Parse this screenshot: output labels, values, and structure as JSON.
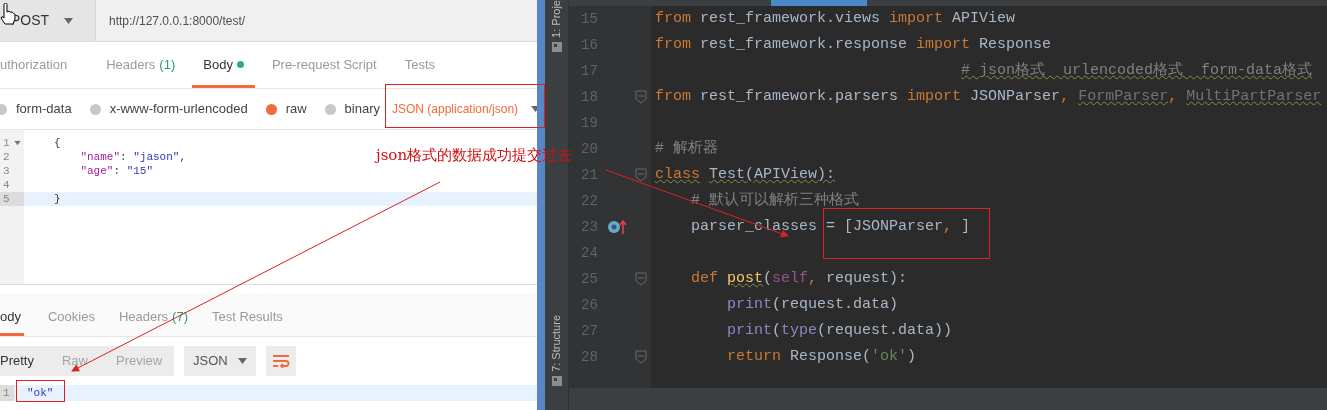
{
  "request": {
    "method": "POST",
    "url": "http://127.0.0.1:8000/test/",
    "tabs": [
      {
        "label": "uthorization",
        "selected": false
      },
      {
        "label": "Headers",
        "count": "(1)",
        "selected": false
      },
      {
        "label": "Body",
        "dot": true,
        "selected": true
      },
      {
        "label": "Pre-request Script",
        "selected": false
      },
      {
        "label": "Tests",
        "selected": false
      }
    ],
    "body_types": [
      {
        "label": "form-data",
        "selected": false
      },
      {
        "label": "x-www-form-urlencoded",
        "selected": false
      },
      {
        "label": "raw",
        "selected": true
      },
      {
        "label": "binary",
        "selected": false
      }
    ],
    "content_type": "JSON (application/json)",
    "editor_lines": [
      {
        "number": "1",
        "fold": true,
        "current": false,
        "tokens": [
          {
            "kind": "punct",
            "text": "{"
          }
        ]
      },
      {
        "number": "2",
        "fold": false,
        "current": false,
        "tokens": [
          {
            "kind": "key",
            "text": "    \"name\""
          },
          {
            "kind": "punct",
            "text": ": "
          },
          {
            "kind": "value",
            "text": "\"jason\""
          },
          {
            "kind": "punct",
            "text": ","
          }
        ]
      },
      {
        "number": "3",
        "fold": false,
        "current": false,
        "tokens": [
          {
            "kind": "key",
            "text": "    \"age\""
          },
          {
            "kind": "punct",
            "text": ": "
          },
          {
            "kind": "value",
            "text": "\"15\""
          }
        ]
      },
      {
        "number": "4",
        "fold": false,
        "current": false
      },
      {
        "number": "5",
        "fold": false,
        "current": true,
        "tokens": [
          {
            "kind": "punct",
            "text": "}"
          }
        ]
      }
    ]
  },
  "response": {
    "tabs": [
      {
        "label": "ody",
        "selected": true
      },
      {
        "label": "Cookies",
        "selected": false
      },
      {
        "label": "Headers",
        "count": "(7)",
        "selected": false
      },
      {
        "label": "Test Results",
        "selected": false
      }
    ],
    "view_modes": [
      {
        "label": "Pretty",
        "selected": true
      },
      {
        "label": "Raw",
        "selected": false
      },
      {
        "label": "Preview",
        "selected": false
      }
    ],
    "format": "JSON",
    "lines": [
      {
        "number": "1",
        "text": "\"ok\""
      }
    ]
  },
  "ide": {
    "tool_tabs": [
      {
        "label": "1: Proje"
      },
      {
        "label": "7: Structure"
      }
    ],
    "lines": [
      {
        "number": "15",
        "fold": false,
        "marker": false,
        "tokens": [
          {
            "kind": "kw",
            "text": "from"
          },
          {
            "kind": "plain",
            "text": " rest_framework.views "
          },
          {
            "kind": "kw",
            "text": "import"
          },
          {
            "kind": "plain",
            "text": " APIView"
          }
        ]
      },
      {
        "number": "16",
        "fold": false,
        "marker": false,
        "tokens": [
          {
            "kind": "kw",
            "text": "from"
          },
          {
            "kind": "plain",
            "text": " rest_framework.response "
          },
          {
            "kind": "kw",
            "text": "import"
          },
          {
            "kind": "plain",
            "text": " Response"
          }
        ]
      },
      {
        "number": "17",
        "fold": false,
        "marker": false,
        "tokens": [
          {
            "kind": "comment",
            "text": "                                  # json格式  urlencoded格式  form-data格式",
            "warn": true
          }
        ]
      },
      {
        "number": "18",
        "fold": true,
        "marker": false,
        "tokens": [
          {
            "kind": "kw",
            "text": "from"
          },
          {
            "kind": "plain",
            "text": " rest_framework.parsers "
          },
          {
            "kind": "kw",
            "text": "import"
          },
          {
            "kind": "plain",
            "text": " JSONParser"
          },
          {
            "kind": "kw",
            "text": ", "
          },
          {
            "kind": "unused",
            "text": "FormParser",
            "warn": true
          },
          {
            "kind": "kw",
            "text": ", "
          },
          {
            "kind": "unused",
            "text": "MultiPartParser",
            "warn": true
          }
        ]
      },
      {
        "number": "19",
        "fold": false,
        "marker": false
      },
      {
        "number": "20",
        "fold": false,
        "marker": false,
        "tokens": [
          {
            "kind": "comment",
            "text": "# 解析器"
          }
        ]
      },
      {
        "number": "21",
        "fold": true,
        "marker": false,
        "tokens": [
          {
            "kind": "kw",
            "text": "class",
            "warn": true
          },
          {
            "kind": "plain",
            "text": " Test(APIView):",
            "warn": true
          }
        ]
      },
      {
        "number": "22",
        "fold": false,
        "marker": false,
        "tokens": [
          {
            "kind": "comment",
            "text": "    # 默认可以解析三种格式"
          }
        ]
      },
      {
        "number": "23",
        "fold": false,
        "marker": true,
        "tokens": [
          {
            "kind": "plain",
            "text": "    parser_classes = [JSONParser"
          },
          {
            "kind": "kw",
            "text": ", "
          },
          {
            "kind": "plain",
            "text": "]"
          }
        ]
      },
      {
        "number": "24",
        "fold": false,
        "marker": false
      },
      {
        "number": "25",
        "fold": true,
        "marker": false,
        "tokens": [
          {
            "kind": "kw",
            "text": "    def "
          },
          {
            "kind": "func",
            "text": "post",
            "warn": true
          },
          {
            "kind": "plain",
            "text": "("
          },
          {
            "kind": "self",
            "text": "self"
          },
          {
            "kind": "kw",
            "text": ", "
          },
          {
            "kind": "plain",
            "text": "request):"
          }
        ]
      },
      {
        "number": "26",
        "fold": false,
        "marker": false,
        "tokens": [
          {
            "kind": "builtin",
            "text": "        print"
          },
          {
            "kind": "plain",
            "text": "(request.data)"
          }
        ]
      },
      {
        "number": "27",
        "fold": false,
        "marker": false,
        "tokens": [
          {
            "kind": "builtin",
            "text": "        print"
          },
          {
            "kind": "plain",
            "text": "("
          },
          {
            "kind": "builtin",
            "text": "type"
          },
          {
            "kind": "plain",
            "text": "(request.data))"
          }
        ]
      },
      {
        "number": "28",
        "fold": true,
        "marker": false,
        "tokens": [
          {
            "kind": "kw",
            "text": "        return"
          },
          {
            "kind": "plain",
            "text": " Response("
          },
          {
            "kind": "string",
            "text": "'ok'"
          },
          {
            "kind": "plain",
            "text": ")"
          }
        ]
      }
    ]
  },
  "annotation": {
    "text": "json格式的数据成功提交过去"
  }
}
